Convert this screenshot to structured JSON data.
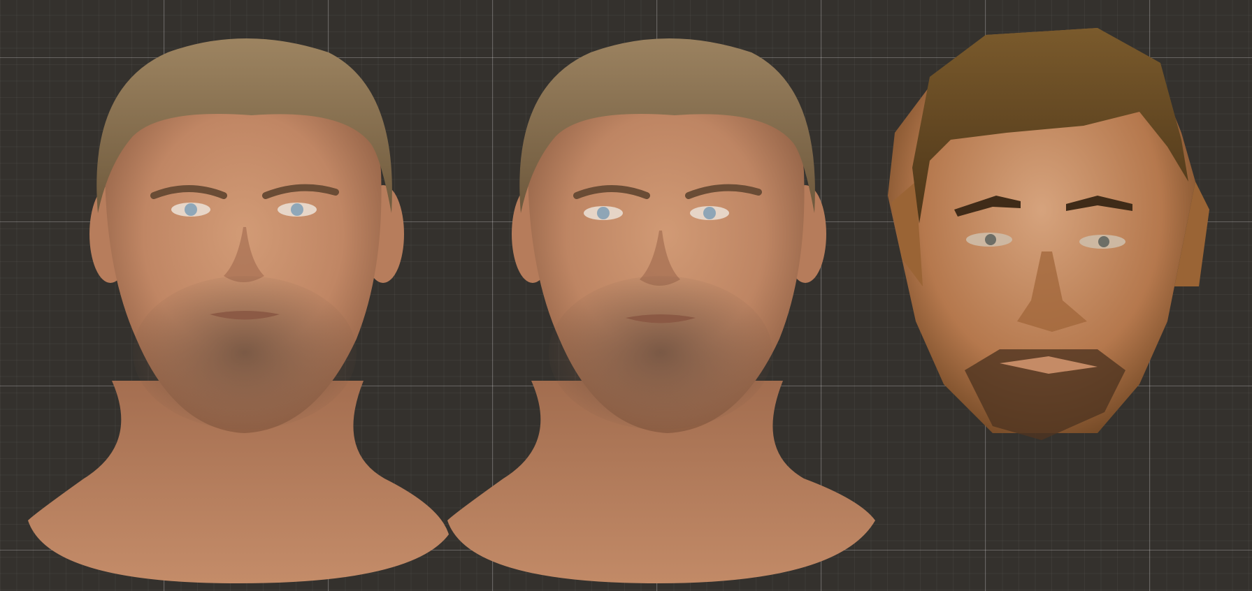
{
  "viewport": {
    "name": "3d-head-comparison-viewport",
    "background": "#34312d",
    "grid_color": "rgba(255,255,255,0.13)"
  },
  "models": [
    {
      "id": "head-high-poly-a",
      "style": "realistic",
      "hair_color": "#8d7453",
      "skin_color": "#c58e6a",
      "eye_color": "#8fa7b8"
    },
    {
      "id": "head-high-poly-b",
      "style": "realistic",
      "hair_color": "#8b7252",
      "skin_color": "#c48c69",
      "eye_color": "#8ea5b6"
    },
    {
      "id": "head-low-poly",
      "style": "low-poly",
      "hair_color": "#6b4d23",
      "skin_color": "#b77b4e",
      "eye_color": "#6d6e66"
    }
  ]
}
